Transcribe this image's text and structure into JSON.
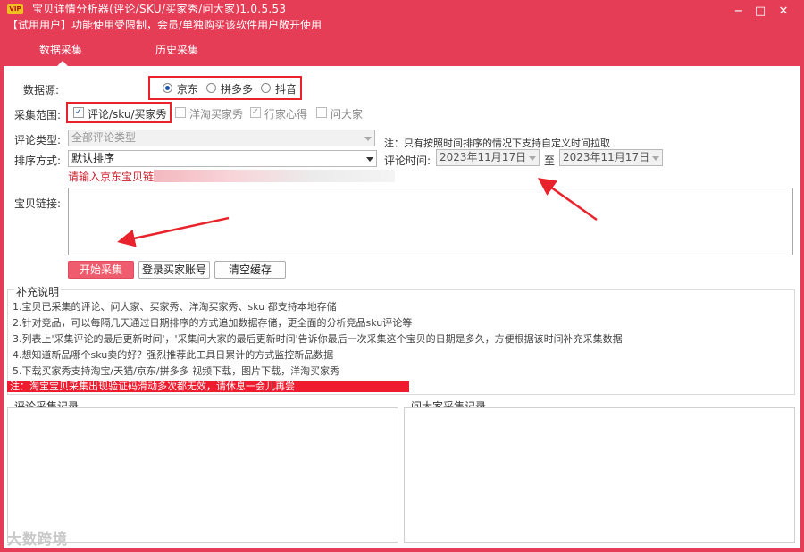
{
  "titlebar": {
    "vip_badge": "VIP",
    "title": "宝贝详情分析器(评论/SKU/买家秀/问大家)1.0.5.53",
    "trial_notice": "【试用用户】功能使用受限制，会员/单独购买该软件用户敞开使用",
    "controls": {
      "minimize": "−",
      "restore": "□",
      "maximize": "▣",
      "close": "✕"
    }
  },
  "tabs": [
    {
      "label": "数据采集",
      "active": true
    },
    {
      "label": "历史采集",
      "active": false
    }
  ],
  "form": {
    "source_label": "数据源:",
    "sources": [
      {
        "label": "京东",
        "selected": true
      },
      {
        "label": "拼多多",
        "selected": false
      },
      {
        "label": "抖音",
        "selected": false
      }
    ],
    "scope_label": "采集范围:",
    "scopes": [
      {
        "label": "评论/sku/买家秀",
        "checked": true,
        "enabled": true
      },
      {
        "label": "洋淘买家秀",
        "checked": false,
        "enabled": false
      },
      {
        "label": "行家心得",
        "checked": true,
        "enabled": false
      },
      {
        "label": "问大家",
        "checked": false,
        "enabled": false
      }
    ],
    "comment_type_label": "评论类型:",
    "comment_type_value": "全部评论类型",
    "time_note": "注：只有按照时间排序的情况下支持自定义时间拉取",
    "sort_label": "排序方式:",
    "sort_value": "默认排序",
    "comment_time_label": "评论时间:",
    "date_from": "2023年11月17日",
    "date_to_sep": "至",
    "date_to": "2023年11月17日",
    "link_hint": "请输入京东宝贝链",
    "link_label": "宝贝链接:"
  },
  "buttons": {
    "start": "开始采集",
    "login": "登录买家账号",
    "clear": "清空缓存"
  },
  "notes": {
    "title": "补充说明",
    "items": [
      "1.宝贝已采集的评论、问大家、买家秀、洋淘买家秀、sku 都支持本地存储",
      "2.针对竞品，可以每隔几天通过日期排序的方式追加数据存储，更全面的分析竞品sku评论等",
      "3.列表上'采集评论的最后更新时间'，'采集问大家的最后更新时间'告诉你最后一次采集这个宝贝的日期是多久，方便根据该时间补充采集数据",
      "4.想知道新品哪个sku卖的好？强烈推荐此工具日累计的方式监控新品数据",
      "5.下载买家秀支持淘宝/天猫/京东/拼多多 视频下载，图片下载，洋淘买家秀"
    ],
    "warning": "注：淘宝宝贝采集出现验证码滑动多次都无效，请休息一会儿再尝"
  },
  "logs": {
    "comment_title": "评论采集记录",
    "ask_title": "问大家采集记录"
  },
  "watermark": "大数跨境",
  "colors": {
    "brand": "#e53d56",
    "highlight": "#e8232b",
    "primary_button": "#ef5c6e",
    "warning_bar": "#ee1c2e"
  }
}
